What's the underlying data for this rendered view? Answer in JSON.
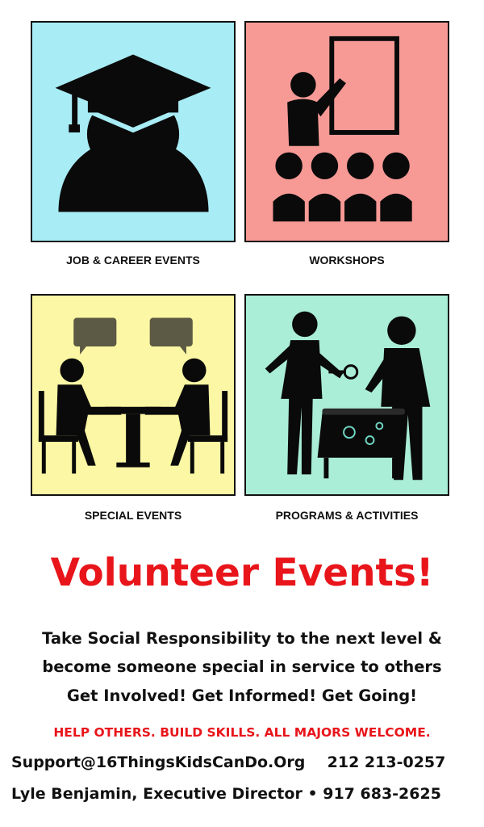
{
  "tiles": [
    {
      "caption": "JOB & CAREER EVENTS",
      "icon": "graduate-icon",
      "bg": "#a8ecf5"
    },
    {
      "caption": "WORKSHOPS",
      "icon": "presenter-audience-icon",
      "bg": "#f79a96"
    },
    {
      "caption": "SPECIAL EVENTS",
      "icon": "meeting-conversation-icon",
      "bg": "#fbf7a4"
    },
    {
      "caption": "PROGRAMS & ACTIVITIES",
      "icon": "business-planning-icon",
      "bg": "#aaeed8"
    }
  ],
  "headline": "Volunteer Events!",
  "body": {
    "line1": "Take Social Responsibility to the next level &",
    "line2": "become someone special in service to others",
    "line3": "Get Involved!  Get Informed!  Get Going!"
  },
  "tagline": "HELP OTHERS. BUILD SKILLS.  ALL MAJORS WELCOME.",
  "contact": {
    "email": "Support@16ThingsKidsCanDo.Org",
    "phone1": "212 213-0257",
    "director": "Lyle Benjamin, Executive Director",
    "bullet": "•",
    "phone2": "917 683-2625"
  },
  "colors": {
    "accent_red": "#e8151b",
    "text": "#111111"
  }
}
